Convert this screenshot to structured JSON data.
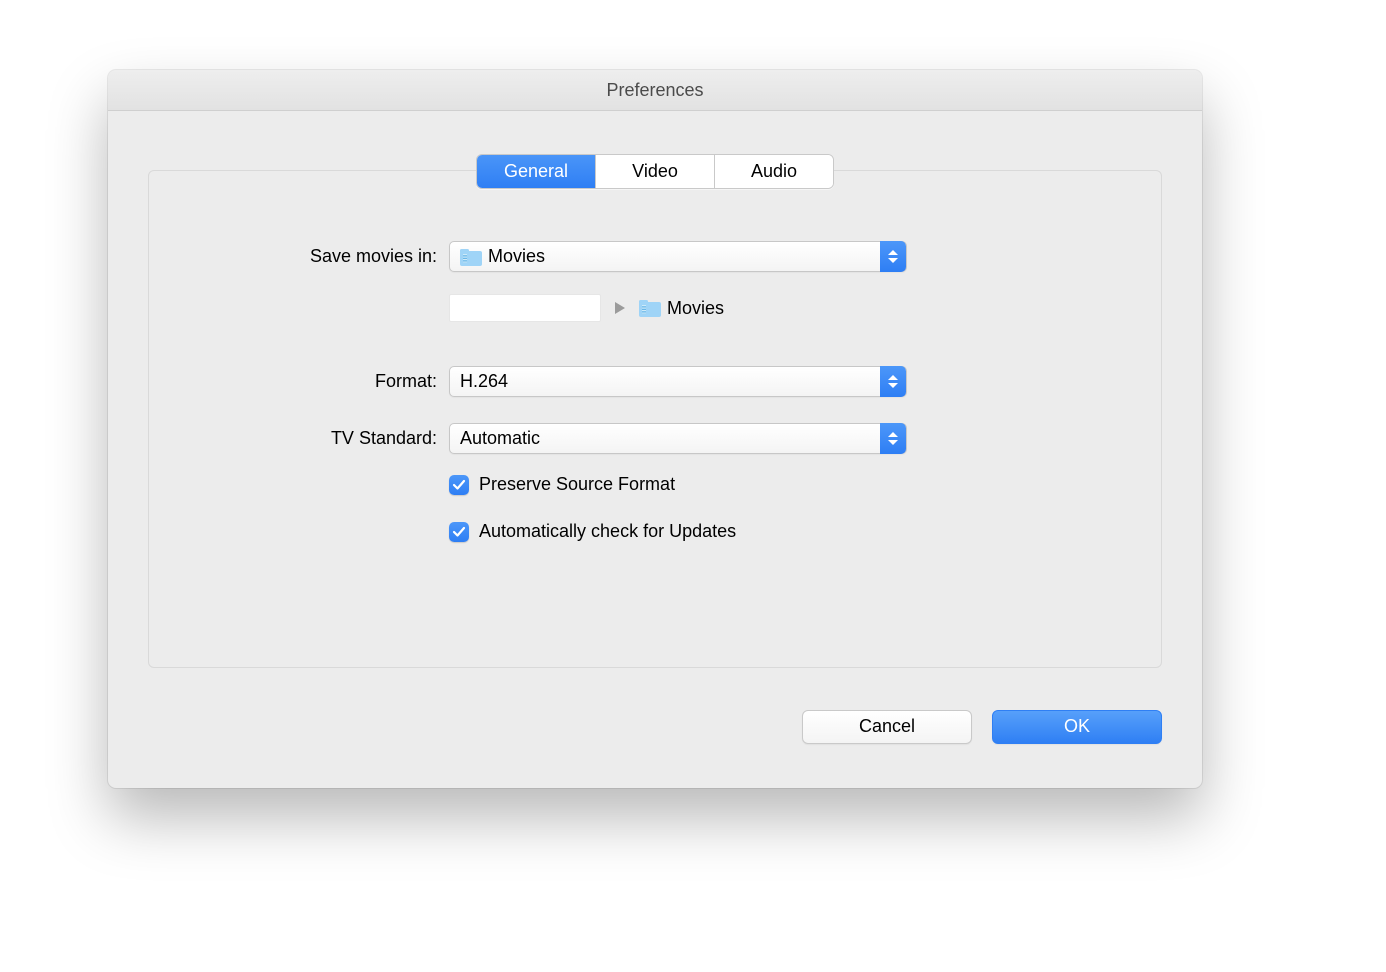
{
  "window": {
    "title": "Preferences"
  },
  "tabs": {
    "general": "General",
    "video": "Video",
    "audio": "Audio",
    "selected": "general"
  },
  "form": {
    "save_movies_label": "Save movies in:",
    "save_movies_value": "Movies",
    "path_display_value": "Movies",
    "format_label": "Format:",
    "format_value": "H.264",
    "tv_standard_label": "TV Standard:",
    "tv_standard_value": "Automatic",
    "preserve_source_label": "Preserve Source Format",
    "preserve_source_checked": true,
    "auto_update_label": "Automatically check for Updates",
    "auto_update_checked": true
  },
  "footer": {
    "cancel": "Cancel",
    "ok": "OK"
  },
  "icons": {
    "folder": "movie-folder-icon",
    "chevron": "chevron-right-icon",
    "updown": "updown-arrows-icon",
    "check": "check-icon"
  }
}
